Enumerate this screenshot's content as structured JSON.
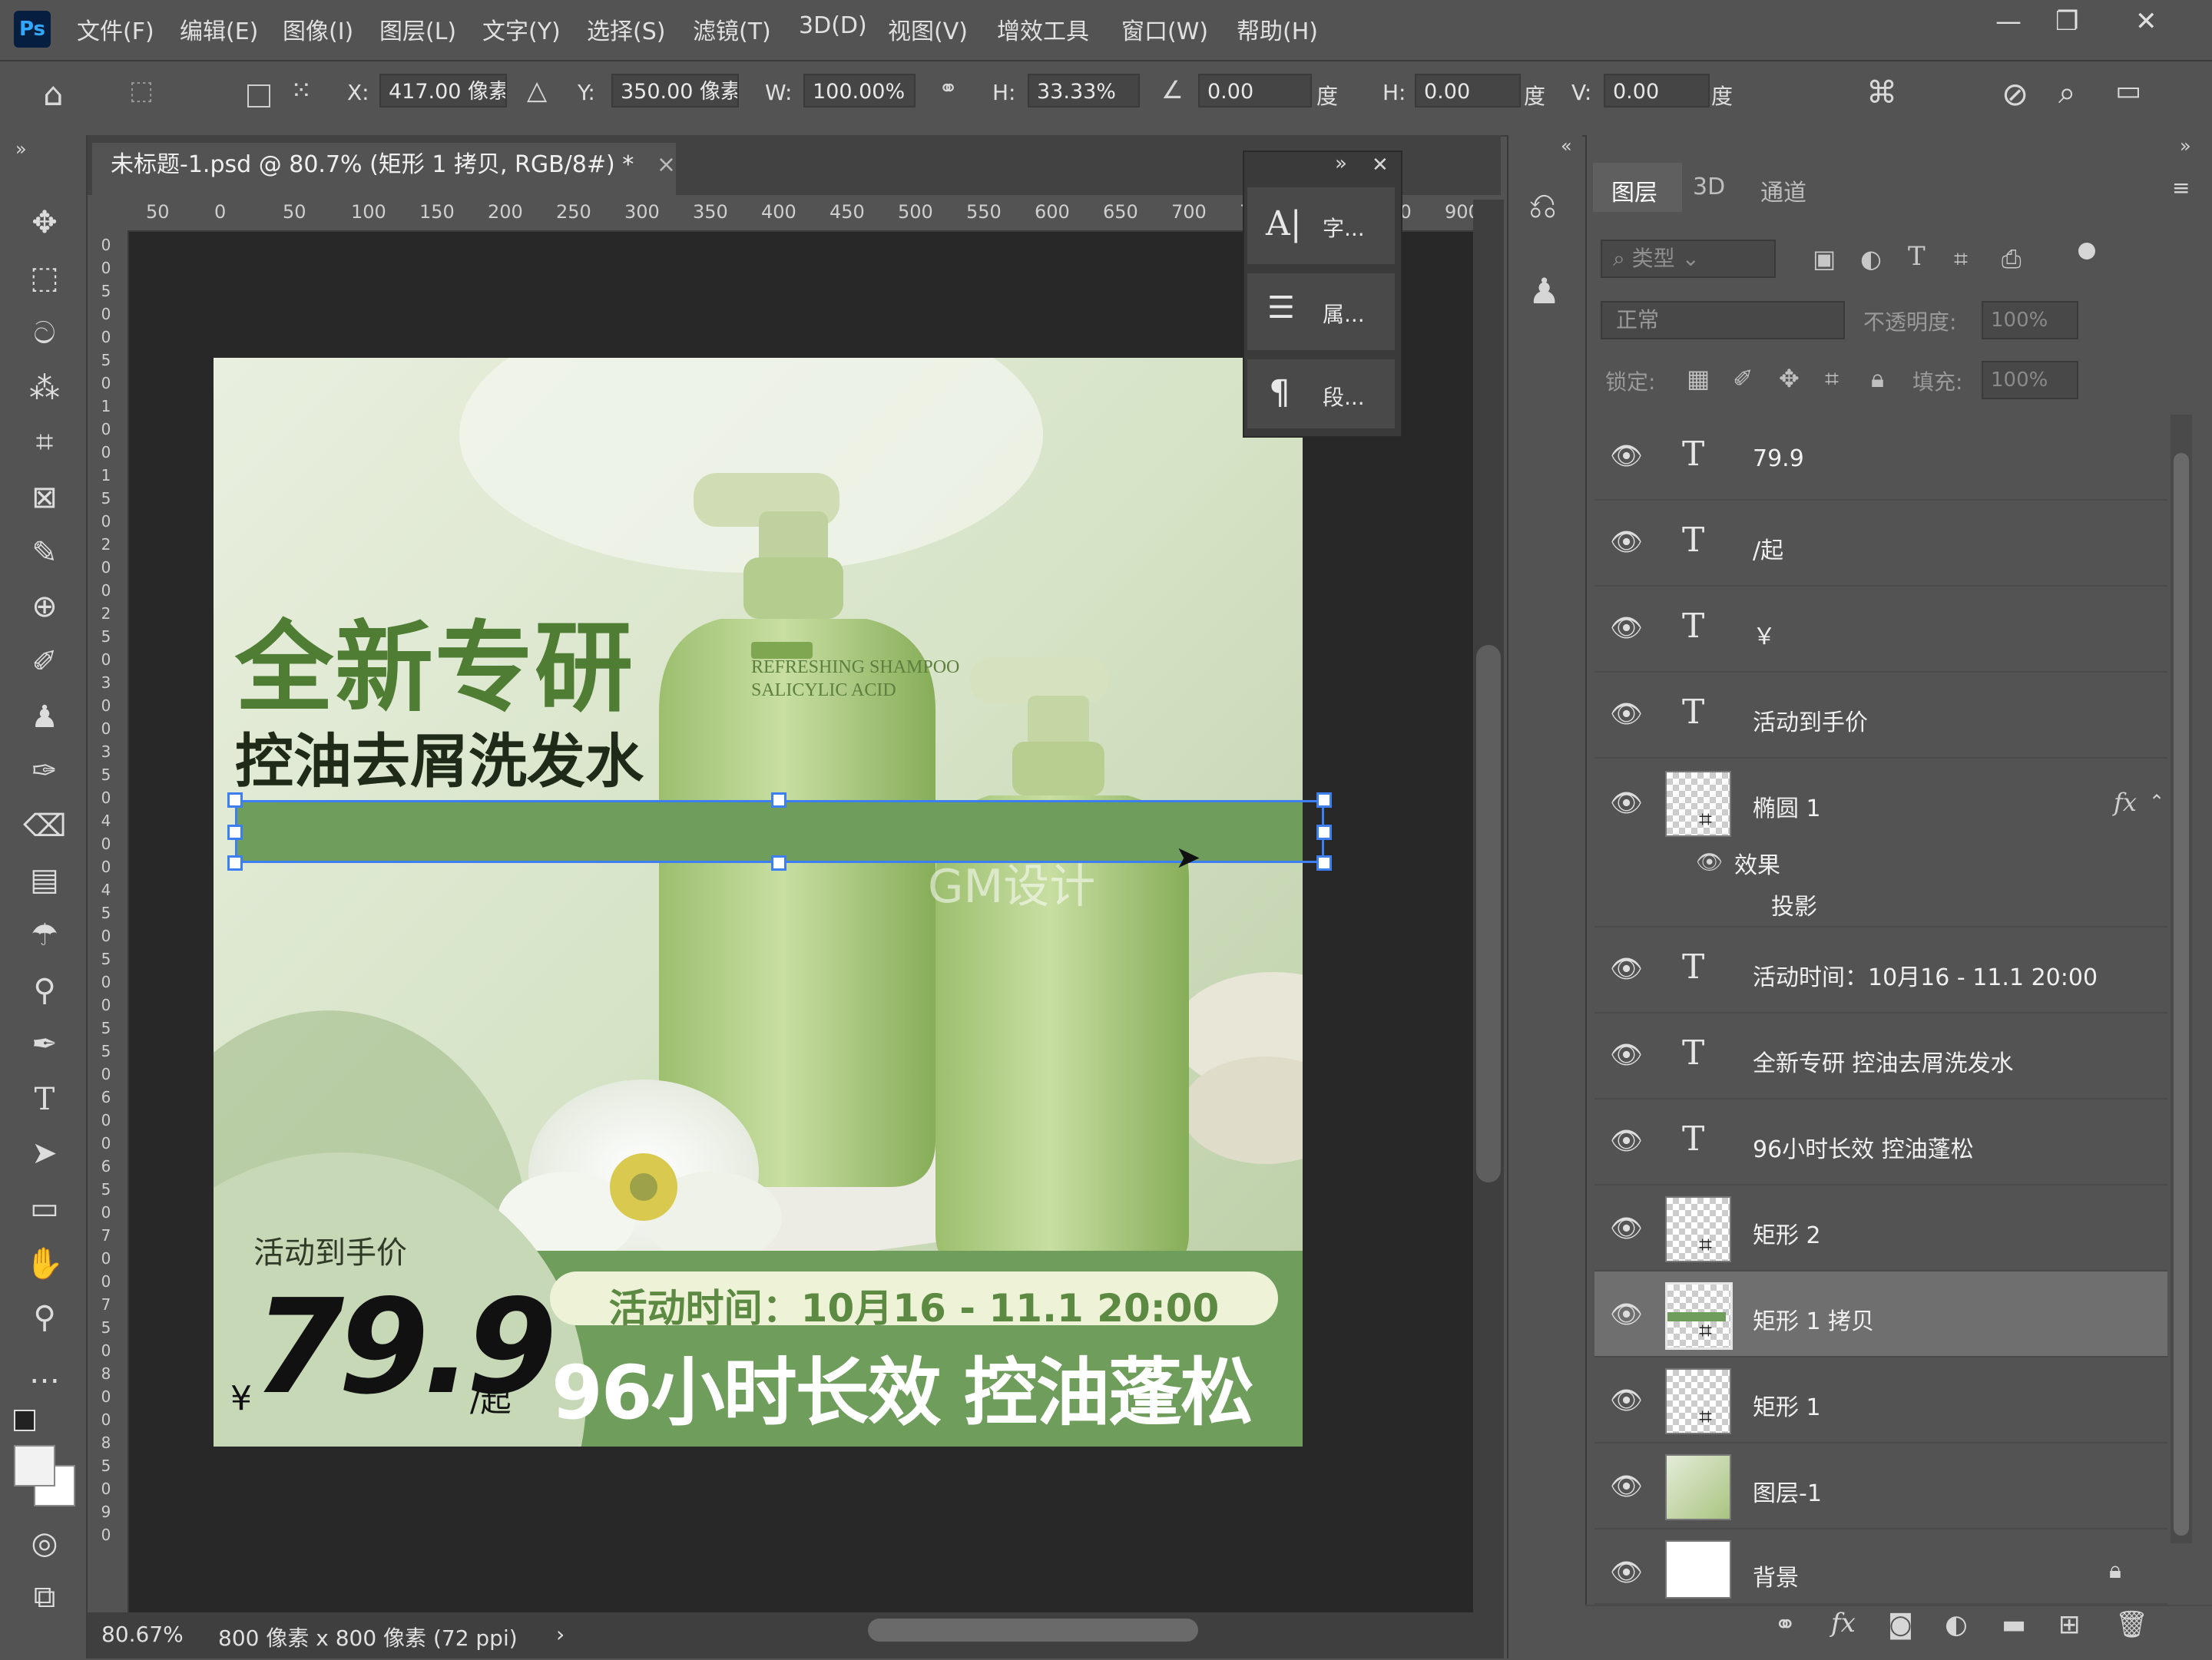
{
  "app": {
    "logo": "Ps"
  },
  "menu": [
    "文件(F)",
    "编辑(E)",
    "图像(I)",
    "图层(L)",
    "文字(Y)",
    "选择(S)",
    "滤镜(T)",
    "3D(D)",
    "视图(V)",
    "增效工具",
    "窗口(W)",
    "帮助(H)"
  ],
  "window_controls": {
    "minimize": "—",
    "restore": "❐",
    "close": "✕"
  },
  "options": {
    "x_label": "X:",
    "x_value": "417.00 像素",
    "y_label": "Y:",
    "y_value": "350.00 像素",
    "w_label": "W:",
    "w_value": "100.00%",
    "h_label": "H:",
    "h_value": "33.33%",
    "angle_value": "0.00",
    "angle_unit": "度",
    "skew_h_label": "H:",
    "skew_h_value": "0.00",
    "skew_h_unit": "度",
    "skew_v_label": "V:",
    "skew_v_value": "0.00",
    "skew_v_unit": "度"
  },
  "document": {
    "tab_title": "未标题-1.psd @ 80.7% (矩形 1 拷贝, RGB/8#) *",
    "tab_close": "×",
    "ruler_h": [
      "50",
      "0",
      "50",
      "100",
      "150",
      "200",
      "250",
      "300",
      "350",
      "400",
      "450",
      "500",
      "550",
      "600",
      "650",
      "700",
      "750",
      "800",
      "850",
      "900"
    ],
    "ruler_v": [
      "0",
      "0",
      "5",
      "0",
      "0",
      "5",
      "0",
      "1",
      "0",
      "0",
      "1",
      "5",
      "0",
      "2",
      "0",
      "0",
      "2",
      "5",
      "0",
      "3",
      "0",
      "0",
      "3",
      "5",
      "0",
      "4",
      "0",
      "0",
      "4",
      "5",
      "0",
      "5",
      "0",
      "0",
      "5",
      "5",
      "0",
      "6",
      "0",
      "0",
      "6",
      "5",
      "0",
      "7",
      "0",
      "0",
      "7",
      "5",
      "0",
      "8",
      "0",
      "0",
      "8",
      "5",
      "0",
      "9",
      "0"
    ]
  },
  "status": {
    "zoom": "80.67%",
    "doc_info": "800 像素 x 800 像素 (72 ppi)",
    "arrow": "›"
  },
  "artwork": {
    "headline": "全新专研",
    "subhead": "控油去屑洗发水",
    "bottle_label_1": "REFRESHING SHAMPOO",
    "bottle_label_2": "SALICYLIC ACID",
    "watermark": "GM设计",
    "price_label": "活动到手价",
    "currency": "¥",
    "price": "79.9",
    "price_suffix": "/起",
    "time_text": "活动时间：10月16 - 11.1 20:00",
    "slogan": "96小时长效 控油蓬松",
    "colors": {
      "brand_green": "#6f9e5c",
      "headline_green": "#4f7d33",
      "price_black": "#111111"
    }
  },
  "float_panel": {
    "collapse": "»",
    "close": "✕",
    "items": [
      {
        "icon": "A|",
        "label": "字..."
      },
      {
        "icon": "☰",
        "label": "属..."
      },
      {
        "icon": "¶",
        "label": "段..."
      }
    ]
  },
  "layers_panel": {
    "tabs": [
      "图层",
      "3D",
      "通道"
    ],
    "filter_placeholder": "类型",
    "blend_mode": "正常",
    "opacity_label": "不透明度:",
    "opacity_value": "100%",
    "lock_label": "锁定:",
    "fill_label": "填充:",
    "fill_value": "100%",
    "layers": [
      {
        "kind": "text",
        "name": "79.9"
      },
      {
        "kind": "text",
        "name": "/起"
      },
      {
        "kind": "text",
        "name": "￥"
      },
      {
        "kind": "text",
        "name": "活动到手价"
      },
      {
        "kind": "shape",
        "name": "椭圆 1",
        "fx": "fx",
        "effect": "效果",
        "effect_item": "投影"
      },
      {
        "kind": "text",
        "name": "活动时间：10月16 - 11.1 20:00"
      },
      {
        "kind": "text",
        "name": "全新专研 控油去屑洗发水"
      },
      {
        "kind": "text",
        "name": "96小时长效 控油蓬松"
      },
      {
        "kind": "shape",
        "name": "矩形 2"
      },
      {
        "kind": "shape",
        "name": "矩形 1 拷贝",
        "selected": true
      },
      {
        "kind": "shape",
        "name": "矩形 1"
      },
      {
        "kind": "image",
        "name": "图层-1"
      },
      {
        "kind": "background",
        "name": "背景"
      }
    ]
  }
}
